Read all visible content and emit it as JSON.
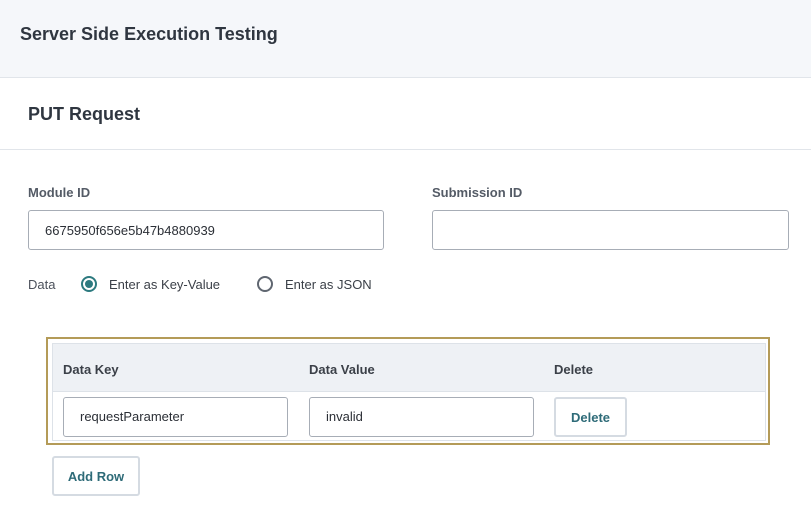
{
  "page": {
    "title": "Server Side Execution Testing"
  },
  "card": {
    "title": "PUT Request"
  },
  "form": {
    "module_id": {
      "label": "Module ID",
      "value": "6675950f656e5b47b4880939"
    },
    "submission_id": {
      "label": "Submission ID",
      "value": ""
    },
    "data": {
      "label": "Data",
      "options": [
        {
          "label": "Enter as Key-Value",
          "checked": true
        },
        {
          "label": "Enter as JSON",
          "checked": false
        }
      ]
    }
  },
  "grid": {
    "columns": [
      "Data Key",
      "Data Value",
      "Delete"
    ],
    "rows": [
      {
        "key": "requestParameter",
        "value": "invalid",
        "delete_label": "Delete"
      }
    ],
    "add_row_label": "Add Row"
  },
  "colors": {
    "accent": "#2d7a7f",
    "highlight_border": "#b49b58",
    "button_text": "#2e6b78"
  }
}
